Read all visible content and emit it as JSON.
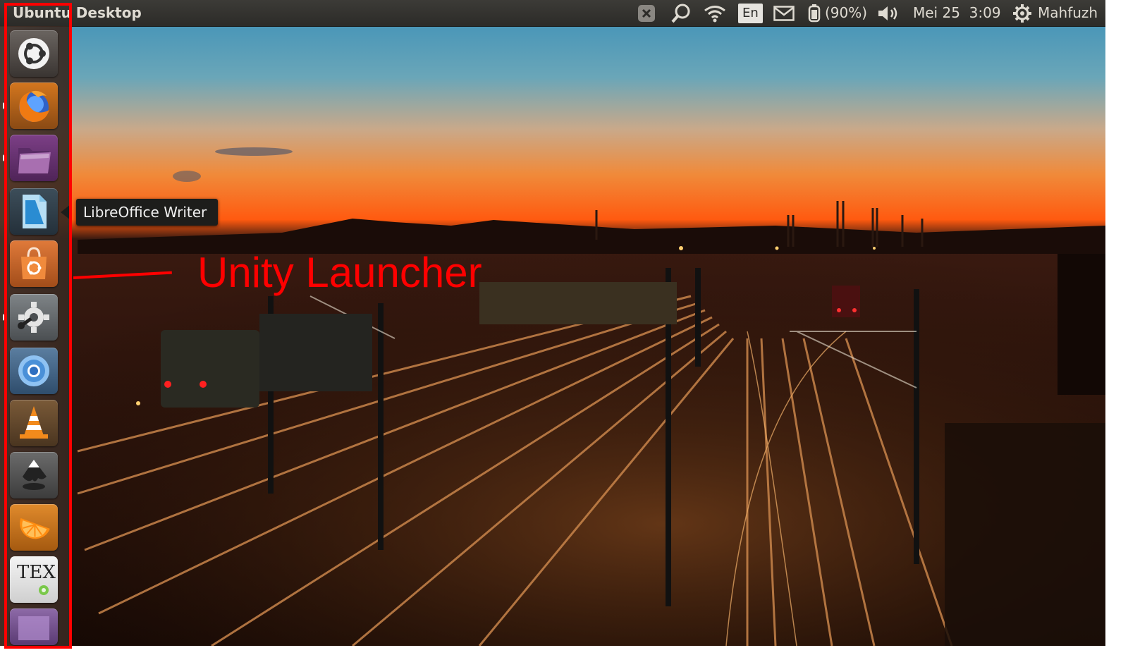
{
  "panel": {
    "title": "Ubuntu Desktop",
    "battery": "(90%)",
    "datetime": "Mei 25  3:09",
    "user": "Mahfuzh",
    "keyboard_language": "En",
    "indicators": [
      "close-window-icon",
      "search-icon",
      "wifi-icon",
      "keyboard-language",
      "mail-icon",
      "battery-icon",
      "volume-icon",
      "clock",
      "power-gear-icon"
    ]
  },
  "launcher": {
    "items": [
      {
        "name": "ubuntu-dash",
        "icon": "ubuntu-logo-icon"
      },
      {
        "name": "firefox",
        "icon": "firefox-icon",
        "running": true
      },
      {
        "name": "files",
        "icon": "folder-icon",
        "running": true
      },
      {
        "name": "libreoffice-writer",
        "icon": "writer-document-icon",
        "hovered": true
      },
      {
        "name": "ubuntu-software-center",
        "icon": "shopping-bag-icon"
      },
      {
        "name": "system-settings",
        "icon": "gear-wrench-icon",
        "running": true
      },
      {
        "name": "chromium",
        "icon": "chromium-icon"
      },
      {
        "name": "vlc",
        "icon": "traffic-cone-icon"
      },
      {
        "name": "inkscape",
        "icon": "inkscape-icon"
      },
      {
        "name": "orange-app",
        "icon": "orange-slice-icon"
      },
      {
        "name": "texmaker",
        "icon": "tex-icon",
        "label": "TEX"
      },
      {
        "name": "workspace-switcher",
        "icon": "workspace-icon"
      }
    ]
  },
  "tooltip": {
    "text": "LibreOffice Writer"
  },
  "annotation": {
    "text": "Unity Launcher",
    "color": "#ff0000"
  },
  "colors": {
    "panel_bg": "#2c2b28",
    "launcher_bg": "#3a2a22",
    "sky_top": "#3a8fb8",
    "sky_orange": "#ff6a1a"
  }
}
